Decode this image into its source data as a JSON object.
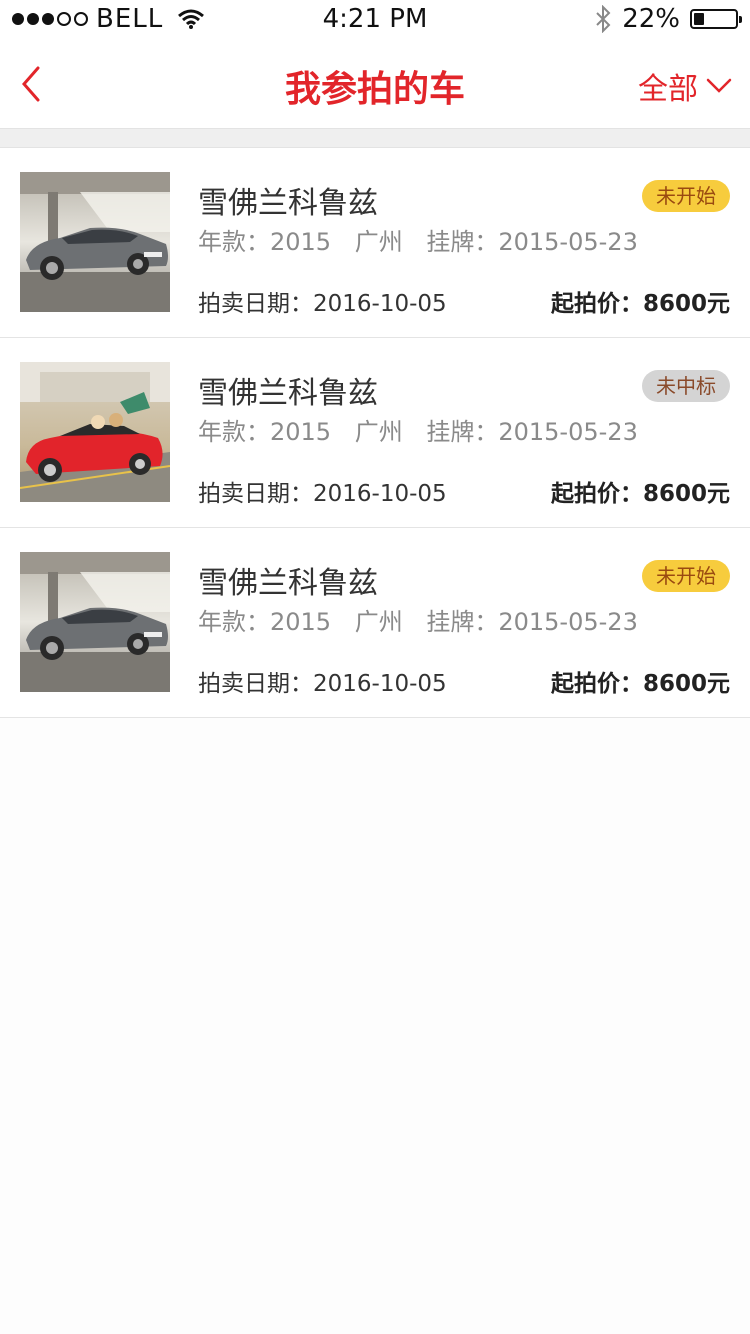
{
  "status_bar": {
    "carrier": "BELL",
    "time": "4:21 PM",
    "battery": "22%"
  },
  "nav": {
    "title": "我参拍的车",
    "filter_label": "全部"
  },
  "items": [
    {
      "name": "雪佛兰科鲁兹",
      "year": "年款：2015",
      "city": "广州",
      "plate_date": "挂牌：2015-05-23",
      "auction_date": "拍卖日期：2016-10-05",
      "price": "起拍价：8600元",
      "status": "未开始",
      "status_color": "#f7cc3d",
      "image": "silver-sedan"
    },
    {
      "name": "雪佛兰科鲁兹",
      "year": "年款：2015",
      "city": "广州",
      "plate_date": "挂牌：2015-05-23",
      "auction_date": "拍卖日期：2016-10-05",
      "price": "起拍价：8600元",
      "status": "未中标",
      "status_color": "#d4d4d4",
      "image": "red-convertible"
    },
    {
      "name": "雪佛兰科鲁兹",
      "year": "年款：2015",
      "city": "广州",
      "plate_date": "挂牌：2015-05-23",
      "auction_date": "拍卖日期：2016-10-05",
      "price": "起拍价：8600元",
      "status": "未开始",
      "status_color": "#f7cc3d",
      "image": "silver-sedan"
    }
  ],
  "colors": {
    "accent": "#e2252a",
    "badge_pending": "#f7cc3d",
    "badge_lost": "#d4d4d4"
  }
}
